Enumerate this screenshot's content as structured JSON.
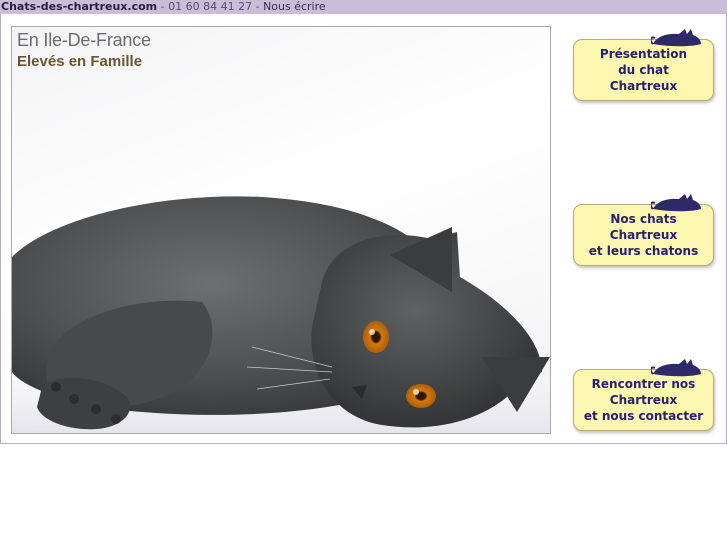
{
  "topbar": {
    "site_name": "Chats-des-chartreux.com",
    "separator1": " - ",
    "phone": "01 60 84 41 27",
    "separator2": " - ",
    "contact_link": "Nous écrire"
  },
  "hero": {
    "caption_line1": "En Ile-De-France",
    "caption_line2": "Elevés en Famille",
    "image_subject": "grey chartreux cat lying down with orange eyes"
  },
  "nav": [
    {
      "label": "Présentation\ndu chat\nChartreux",
      "icon": "cat-silhouette-icon"
    },
    {
      "label": "Nos chats\nChartreux\net leurs chatons",
      "icon": "cat-silhouette-icon"
    },
    {
      "label": "Rencontrer nos\nChartreux\net nous contacter",
      "icon": "cat-silhouette-icon"
    }
  ],
  "colors": {
    "topbar_bg": "#c9bed8",
    "button_bg": "#fbf6b0",
    "button_text": "#2a2070",
    "caption_brown": "#6a5532"
  }
}
